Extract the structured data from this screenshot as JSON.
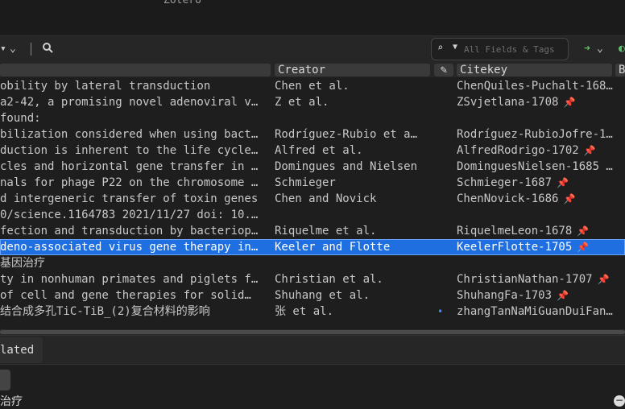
{
  "window": {
    "title": "Zotero"
  },
  "toolbar": {
    "collection_menu_icon": "filter-icon",
    "search_icon": "magnifier-icon",
    "search_placeholder": "All Fields & Tags",
    "sync_icon": "arrow-icon"
  },
  "columns": {
    "title": "",
    "creator": "Creator",
    "citekey": "Citekey"
  },
  "items": [
    {
      "title": "obility by lateral transduction",
      "creator": "Chen et al.",
      "citekey": "ChenQuiles-Puchalt-168…",
      "pinned": false,
      "selected": false
    },
    {
      "title": "a2-42, a promising novel adenoviral v…",
      "creator": "Z et al.",
      "citekey": "ZSvjetlana-1708",
      "pinned": true,
      "selected": false
    },
    {
      "title": " found:",
      "creator": "",
      "citekey": "",
      "pinned": false,
      "selected": false
    },
    {
      "title": "bilization considered when using bact…",
      "creator": "Rodríguez-Rubio et a…",
      "citekey": "Rodríguez-RubioJofre-1…",
      "pinned": false,
      "selected": false
    },
    {
      "title": "duction is inherent to the life cycle…",
      "creator": "Alfred et al.",
      "citekey": "AlfredRodrigo-1702",
      "pinned": true,
      "selected": false
    },
    {
      "title": "cles and horizontal gene transfer in …",
      "creator": "Domingues and Nielsen",
      "citekey": "DominguesNielsen-1685 …",
      "pinned": false,
      "selected": false
    },
    {
      "title": "nals for phage P22 on the chromosome …",
      "creator": "Schmieger",
      "citekey": "Schmieger-1687",
      "pinned": true,
      "selected": false
    },
    {
      "title": "d intergeneric transfer of toxin genes",
      "creator": "Chen and Novick",
      "citekey": "ChenNovick-1686",
      "pinned": true,
      "selected": false
    },
    {
      "title": "0/science.1164783 2021/11/27 doi: 10.…",
      "creator": "",
      "citekey": "",
      "pinned": false,
      "selected": false
    },
    {
      "title": "fection and transduction by bacteriop…",
      "creator": "Riquelme et al.",
      "citekey": "RiquelmeLeon-1678",
      "pinned": true,
      "selected": false
    },
    {
      "title": "deno-associated virus gene therapy in…",
      "creator": "Keeler and Flotte",
      "citekey": "KeelerFlotte-1705",
      "pinned": true,
      "selected": true
    },
    {
      "title": "基因治疗",
      "creator": "",
      "citekey": "",
      "pinned": false,
      "selected": false
    },
    {
      "title": "ty in nonhuman primates and piglets f…",
      "creator": "Christian et al.",
      "citekey": "ChristianNathan-1707",
      "pinned": true,
      "selected": false
    },
    {
      "title": " of cell and gene therapies for solid…",
      "creator": "Shuhang et al.",
      "citekey": "ShuhangFa-1703",
      "pinned": true,
      "selected": false
    },
    {
      "title": "结合成多孔TiC-TiB_(2)复合材料的影响",
      "creator": "张 et al.",
      "citekey": "zhangTanNaMiGuanDuiFan…",
      "pinned": false,
      "selected": false,
      "dot": true
    }
  ],
  "bottom": {
    "tab_label": "lated",
    "text": "治疗"
  }
}
